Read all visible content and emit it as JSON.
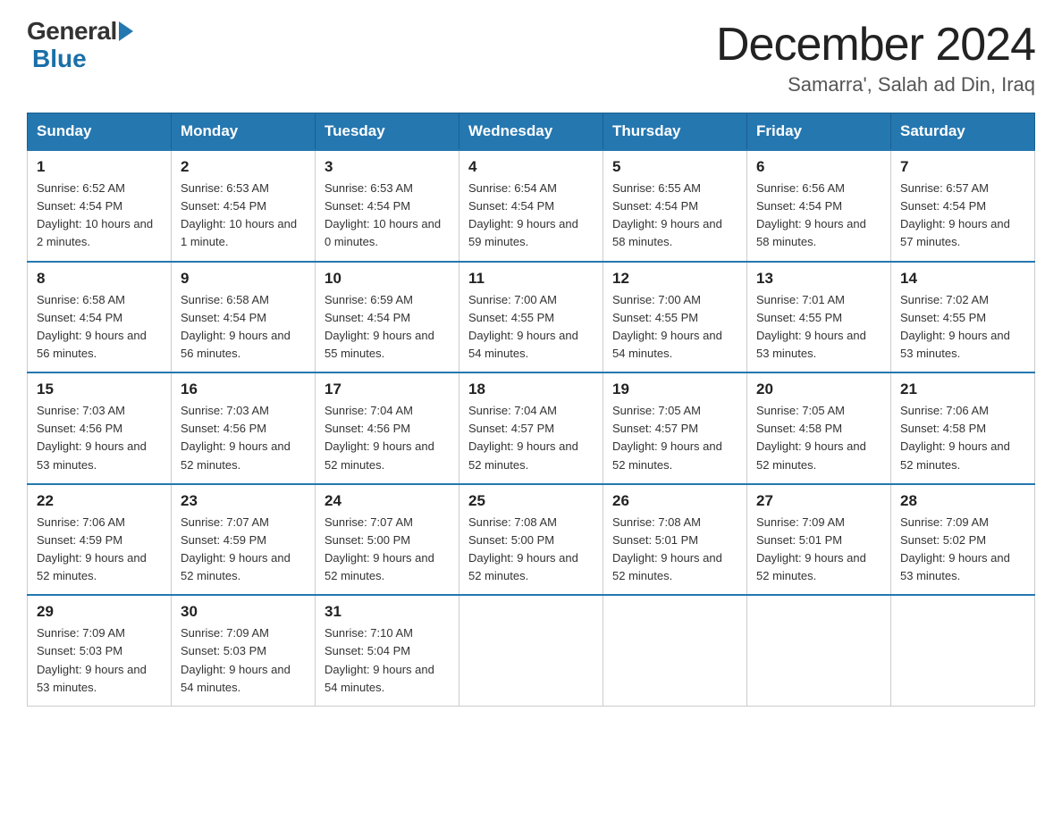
{
  "header": {
    "logo_general": "General",
    "logo_blue": "Blue",
    "title": "December 2024",
    "location": "Samarra', Salah ad Din, Iraq"
  },
  "days_of_week": [
    "Sunday",
    "Monday",
    "Tuesday",
    "Wednesday",
    "Thursday",
    "Friday",
    "Saturday"
  ],
  "weeks": [
    [
      {
        "num": "1",
        "sunrise": "6:52 AM",
        "sunset": "4:54 PM",
        "daylight": "10 hours and 2 minutes."
      },
      {
        "num": "2",
        "sunrise": "6:53 AM",
        "sunset": "4:54 PM",
        "daylight": "10 hours and 1 minute."
      },
      {
        "num": "3",
        "sunrise": "6:53 AM",
        "sunset": "4:54 PM",
        "daylight": "10 hours and 0 minutes."
      },
      {
        "num": "4",
        "sunrise": "6:54 AM",
        "sunset": "4:54 PM",
        "daylight": "9 hours and 59 minutes."
      },
      {
        "num": "5",
        "sunrise": "6:55 AM",
        "sunset": "4:54 PM",
        "daylight": "9 hours and 58 minutes."
      },
      {
        "num": "6",
        "sunrise": "6:56 AM",
        "sunset": "4:54 PM",
        "daylight": "9 hours and 58 minutes."
      },
      {
        "num": "7",
        "sunrise": "6:57 AM",
        "sunset": "4:54 PM",
        "daylight": "9 hours and 57 minutes."
      }
    ],
    [
      {
        "num": "8",
        "sunrise": "6:58 AM",
        "sunset": "4:54 PM",
        "daylight": "9 hours and 56 minutes."
      },
      {
        "num": "9",
        "sunrise": "6:58 AM",
        "sunset": "4:54 PM",
        "daylight": "9 hours and 56 minutes."
      },
      {
        "num": "10",
        "sunrise": "6:59 AM",
        "sunset": "4:54 PM",
        "daylight": "9 hours and 55 minutes."
      },
      {
        "num": "11",
        "sunrise": "7:00 AM",
        "sunset": "4:55 PM",
        "daylight": "9 hours and 54 minutes."
      },
      {
        "num": "12",
        "sunrise": "7:00 AM",
        "sunset": "4:55 PM",
        "daylight": "9 hours and 54 minutes."
      },
      {
        "num": "13",
        "sunrise": "7:01 AM",
        "sunset": "4:55 PM",
        "daylight": "9 hours and 53 minutes."
      },
      {
        "num": "14",
        "sunrise": "7:02 AM",
        "sunset": "4:55 PM",
        "daylight": "9 hours and 53 minutes."
      }
    ],
    [
      {
        "num": "15",
        "sunrise": "7:03 AM",
        "sunset": "4:56 PM",
        "daylight": "9 hours and 53 minutes."
      },
      {
        "num": "16",
        "sunrise": "7:03 AM",
        "sunset": "4:56 PM",
        "daylight": "9 hours and 52 minutes."
      },
      {
        "num": "17",
        "sunrise": "7:04 AM",
        "sunset": "4:56 PM",
        "daylight": "9 hours and 52 minutes."
      },
      {
        "num": "18",
        "sunrise": "7:04 AM",
        "sunset": "4:57 PM",
        "daylight": "9 hours and 52 minutes."
      },
      {
        "num": "19",
        "sunrise": "7:05 AM",
        "sunset": "4:57 PM",
        "daylight": "9 hours and 52 minutes."
      },
      {
        "num": "20",
        "sunrise": "7:05 AM",
        "sunset": "4:58 PM",
        "daylight": "9 hours and 52 minutes."
      },
      {
        "num": "21",
        "sunrise": "7:06 AM",
        "sunset": "4:58 PM",
        "daylight": "9 hours and 52 minutes."
      }
    ],
    [
      {
        "num": "22",
        "sunrise": "7:06 AM",
        "sunset": "4:59 PM",
        "daylight": "9 hours and 52 minutes."
      },
      {
        "num": "23",
        "sunrise": "7:07 AM",
        "sunset": "4:59 PM",
        "daylight": "9 hours and 52 minutes."
      },
      {
        "num": "24",
        "sunrise": "7:07 AM",
        "sunset": "5:00 PM",
        "daylight": "9 hours and 52 minutes."
      },
      {
        "num": "25",
        "sunrise": "7:08 AM",
        "sunset": "5:00 PM",
        "daylight": "9 hours and 52 minutes."
      },
      {
        "num": "26",
        "sunrise": "7:08 AM",
        "sunset": "5:01 PM",
        "daylight": "9 hours and 52 minutes."
      },
      {
        "num": "27",
        "sunrise": "7:09 AM",
        "sunset": "5:01 PM",
        "daylight": "9 hours and 52 minutes."
      },
      {
        "num": "28",
        "sunrise": "7:09 AM",
        "sunset": "5:02 PM",
        "daylight": "9 hours and 53 minutes."
      }
    ],
    [
      {
        "num": "29",
        "sunrise": "7:09 AM",
        "sunset": "5:03 PM",
        "daylight": "9 hours and 53 minutes."
      },
      {
        "num": "30",
        "sunrise": "7:09 AM",
        "sunset": "5:03 PM",
        "daylight": "9 hours and 54 minutes."
      },
      {
        "num": "31",
        "sunrise": "7:10 AM",
        "sunset": "5:04 PM",
        "daylight": "9 hours and 54 minutes."
      },
      null,
      null,
      null,
      null
    ]
  ],
  "labels": {
    "sunrise": "Sunrise: ",
    "sunset": "Sunset: ",
    "daylight": "Daylight: "
  }
}
